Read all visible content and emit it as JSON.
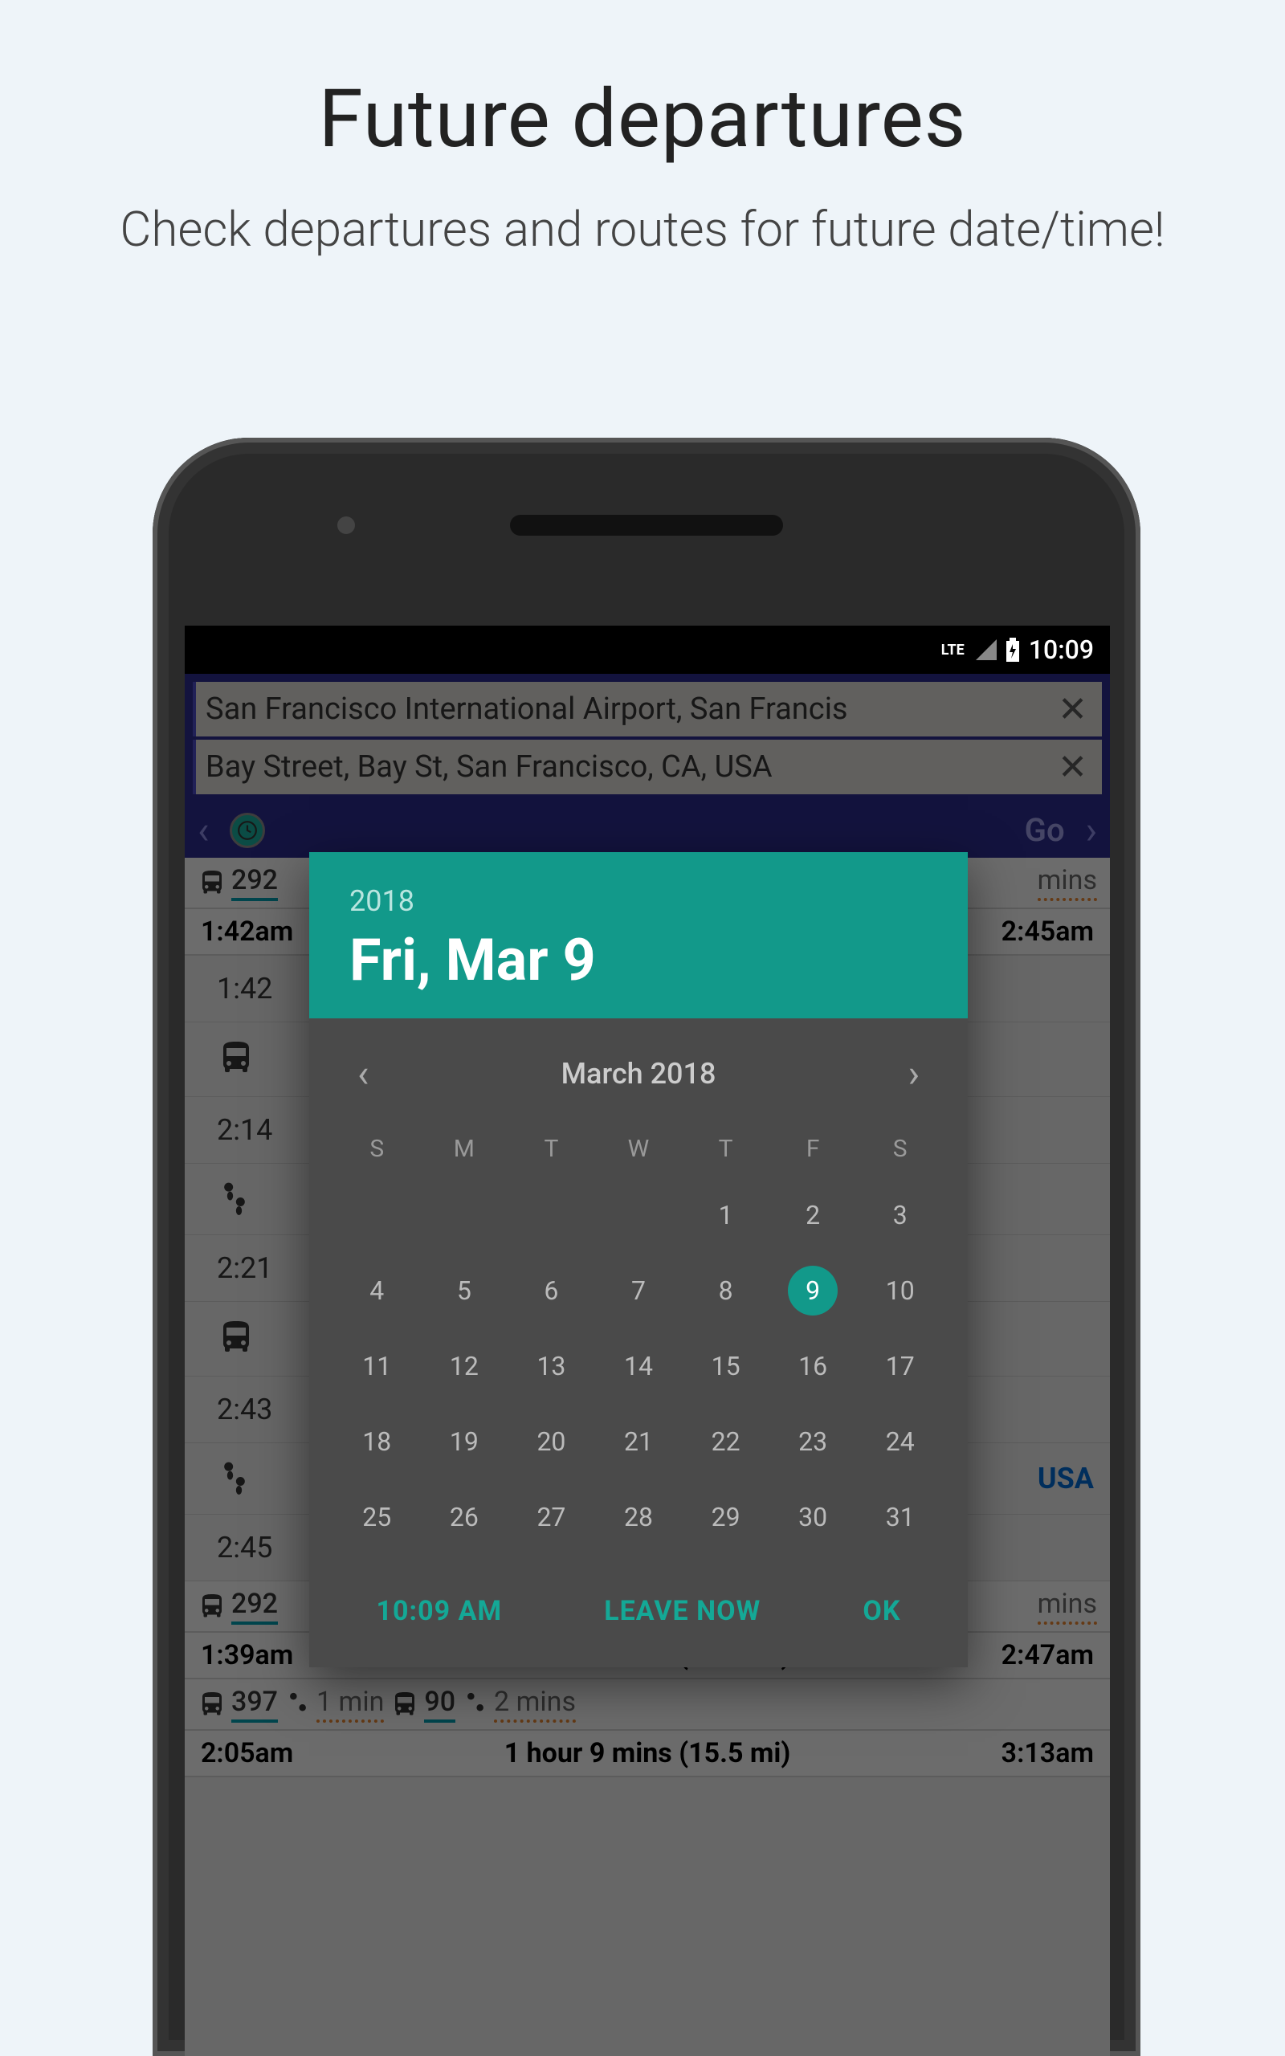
{
  "promo": {
    "title": "Future departures",
    "subtitle": "Check departures and routes for future date/time!"
  },
  "status": {
    "network": "LTE",
    "time": "10:09"
  },
  "search": {
    "from": "San Francisco International Airport, San Francis",
    "to": "Bay Street, Bay St, San Francisco, CA, USA"
  },
  "nav": {
    "go": "Go"
  },
  "routes": {
    "r0": {
      "seg1_num": "292",
      "seg2_dur": "mins",
      "depart": "1:42am",
      "arrive": "2:45am"
    },
    "steps": {
      "s0_time": "1:42",
      "s1_time": "2:14",
      "s2_time": "2:21",
      "s3_time": "2:43",
      "s4_time": "2:45",
      "dest_suffix": "USA"
    },
    "r1": {
      "seg1_num": "292",
      "seg2_dur": "mins",
      "depart": "1:39am",
      "duration": "1 hour 9 mins (17.3 mi)",
      "arrive": "2:47am"
    },
    "r2": {
      "seg1_num": "397",
      "seg2_dur": "1 min",
      "seg3_num": "90",
      "seg4_dur": "2 mins",
      "depart": "2:05am",
      "duration": "1 hour 9 mins (15.5 mi)",
      "arrive": "3:13am"
    }
  },
  "datepicker": {
    "year": "2018",
    "date_label": "Fri, Mar 9",
    "month_label": "March 2018",
    "dow": [
      "S",
      "M",
      "T",
      "W",
      "T",
      "F",
      "S"
    ],
    "days": {
      "d1": "1",
      "d2": "2",
      "d3": "3",
      "d4": "4",
      "d5": "5",
      "d6": "6",
      "d7": "7",
      "d8": "8",
      "d9": "9",
      "d10": "10",
      "d11": "11",
      "d12": "12",
      "d13": "13",
      "d14": "14",
      "d15": "15",
      "d16": "16",
      "d17": "17",
      "d18": "18",
      "d19": "19",
      "d20": "20",
      "d21": "21",
      "d22": "22",
      "d23": "23",
      "d24": "24",
      "d25": "25",
      "d26": "26",
      "d27": "27",
      "d28": "28",
      "d29": "29",
      "d30": "30",
      "d31": "31"
    },
    "selected_day": 9,
    "actions": {
      "time": "10:09 AM",
      "leave_now": "LEAVE NOW",
      "ok": "OK"
    }
  }
}
